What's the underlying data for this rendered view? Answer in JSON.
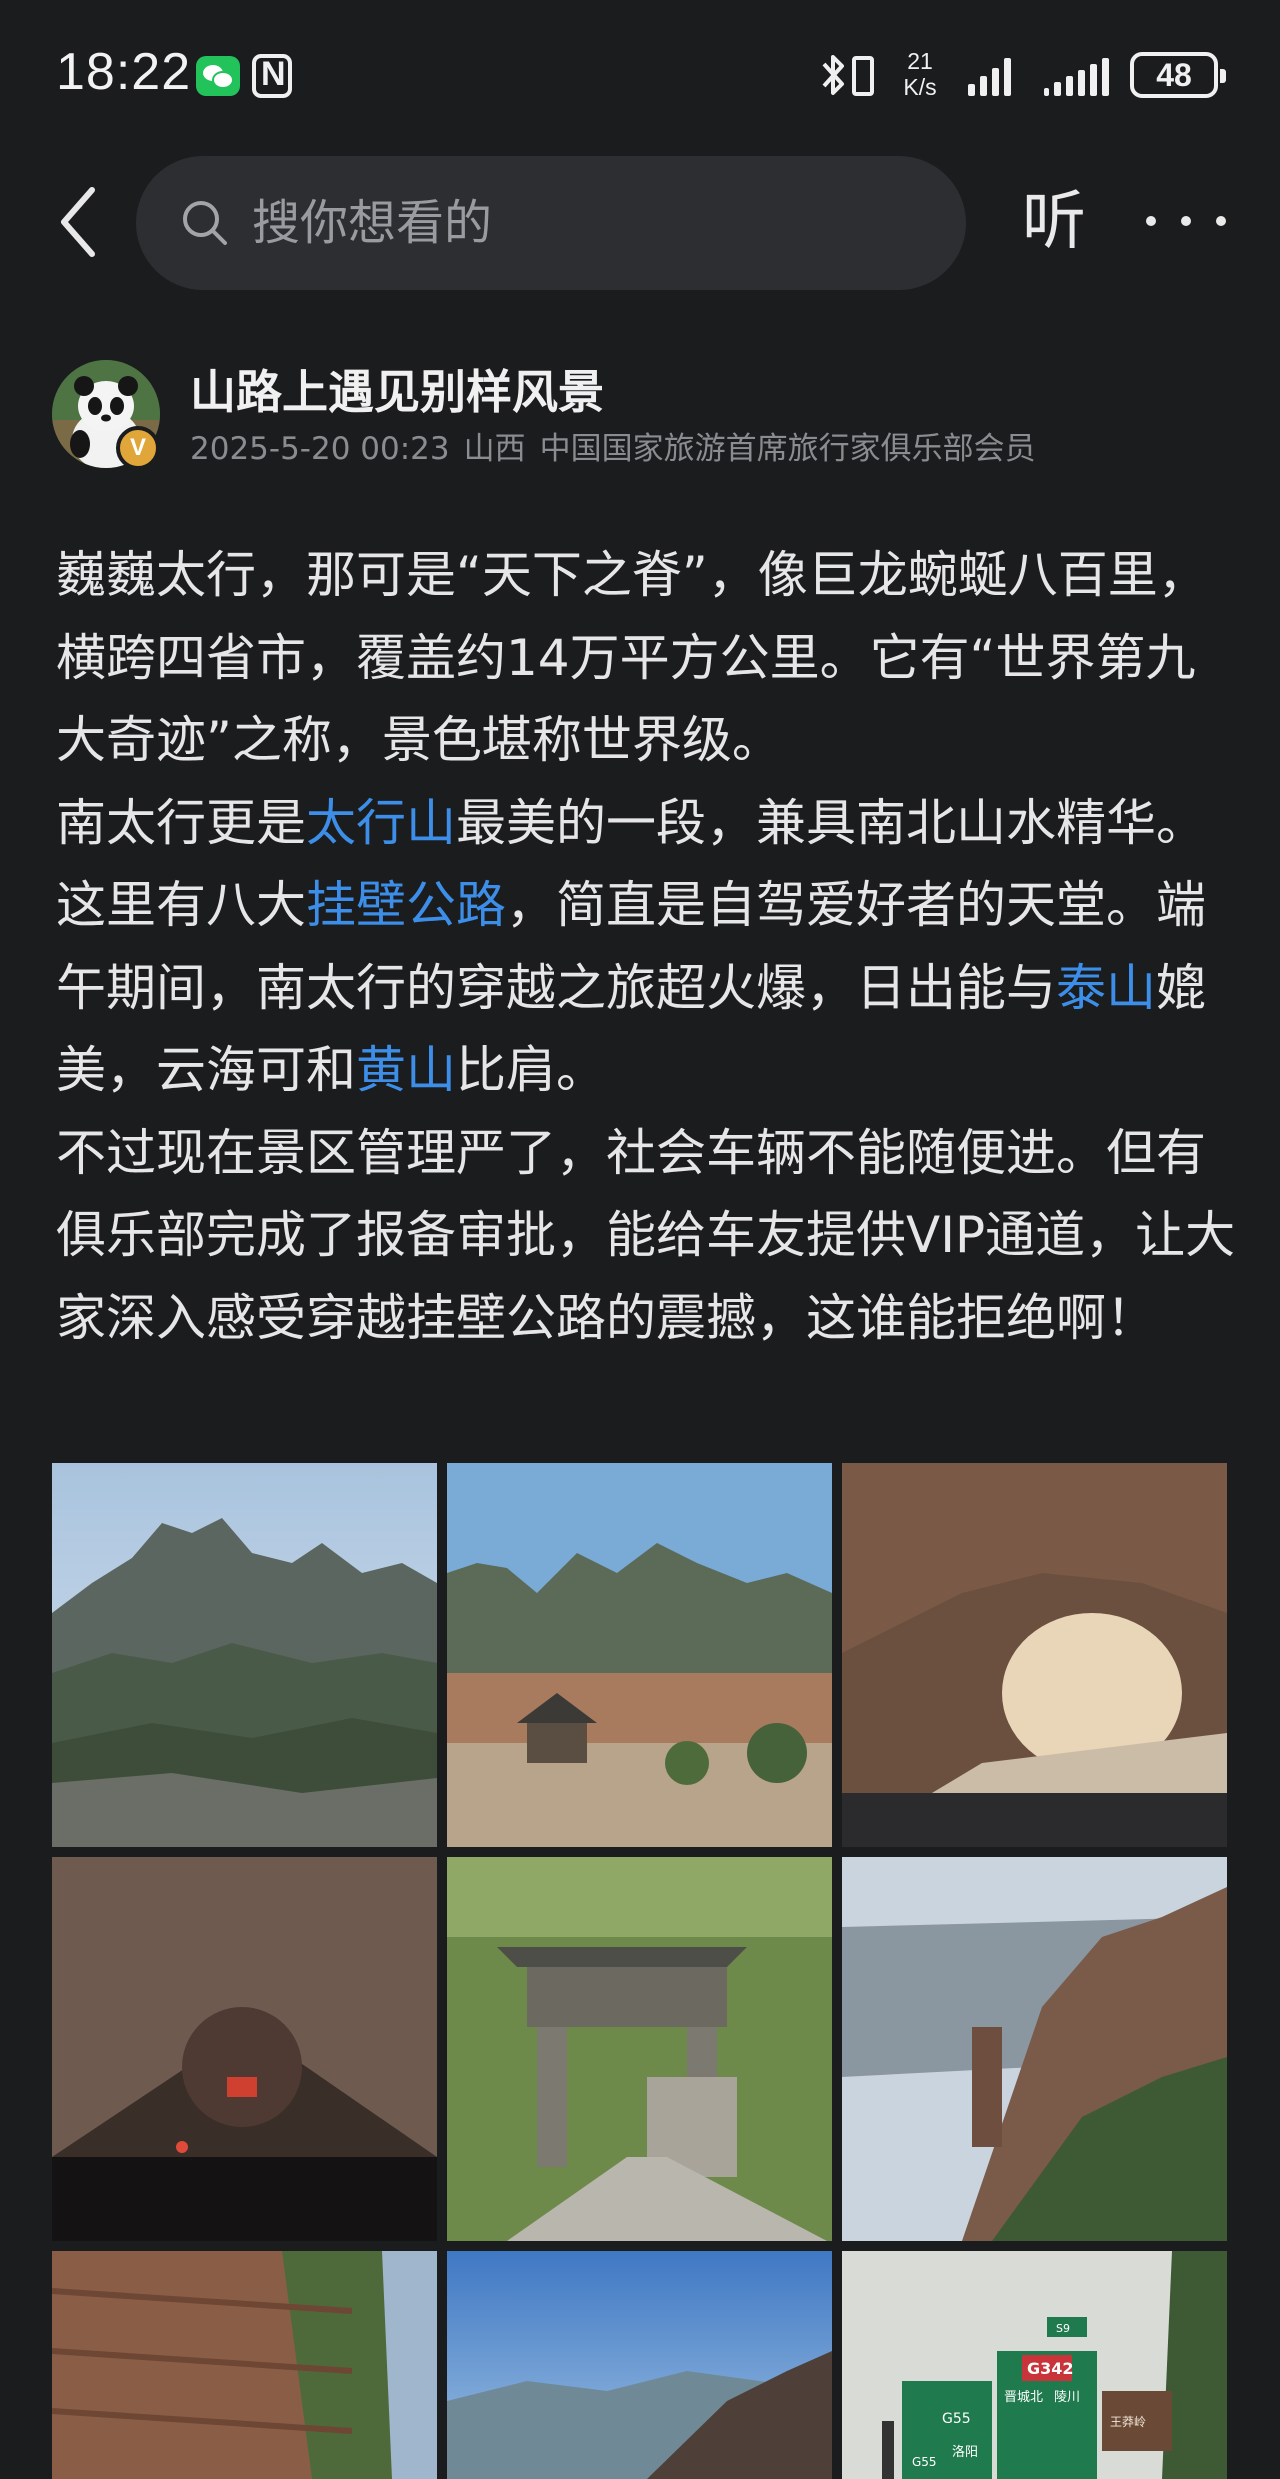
{
  "status_bar": {
    "time": "18:22",
    "net_speed_value": "21",
    "net_speed_unit": "K/s",
    "battery": "48",
    "icons": [
      "wechat-icon",
      "nfc-icon",
      "bluetooth-icon",
      "battery-saver-icon",
      "signal-icon",
      "signal-icon"
    ]
  },
  "nav": {
    "search_placeholder": "搜你想看的",
    "listen_label": "听",
    "icons": [
      "back-icon",
      "search-icon",
      "more-icon"
    ]
  },
  "author": {
    "name": "山路上遇见别样风景",
    "badge": "V",
    "date": "2025-5-20 00:23",
    "location": "山西",
    "title": "中国国家旅游首席旅行家俱乐部会员"
  },
  "post": {
    "p1": "巍巍太行，那可是“天下之脊”，像巨龙蜿蜒八百里，横跨四省市，覆盖约14万平方公里。它有“世界第九大奇迹”之称，景色堪称世界级。",
    "p2_a": "南太行更是",
    "p2_link1": "太行山",
    "p2_b": "最美的一段，兼具南北山水精华。这里有八大",
    "p2_link2": "挂壁公路",
    "p2_c": "，简直是自驾爱好者的天堂。端午期间，南太行的穿越之旅超火爆，日出能与",
    "p2_link3": "泰山",
    "p2_d": "媲美，云海可和",
    "p2_link4": "黄山",
    "p2_e": "比肩。",
    "p3": "不过现在景区管理严了，社会车辆不能随便进。但有俱乐部完成了报备审批，能给车友提供VIP通道，让大家深入感受穿越挂壁公路的震撼，这谁能拒绝啊！"
  },
  "photos": {
    "sign_g55_left": "G55",
    "sign_g55_right": "G55",
    "sign_g342": "G342",
    "sign_city_1": "晋城北",
    "sign_city_2": "陵川",
    "sign_city_3": "洛阳",
    "sign_city_4": "王莽岭",
    "sign_small": "S9"
  },
  "colors": {
    "background": "#1b1c1e",
    "link": "#3d8ee8",
    "meta": "#8b8c90",
    "search_bg": "#2d2e31"
  }
}
